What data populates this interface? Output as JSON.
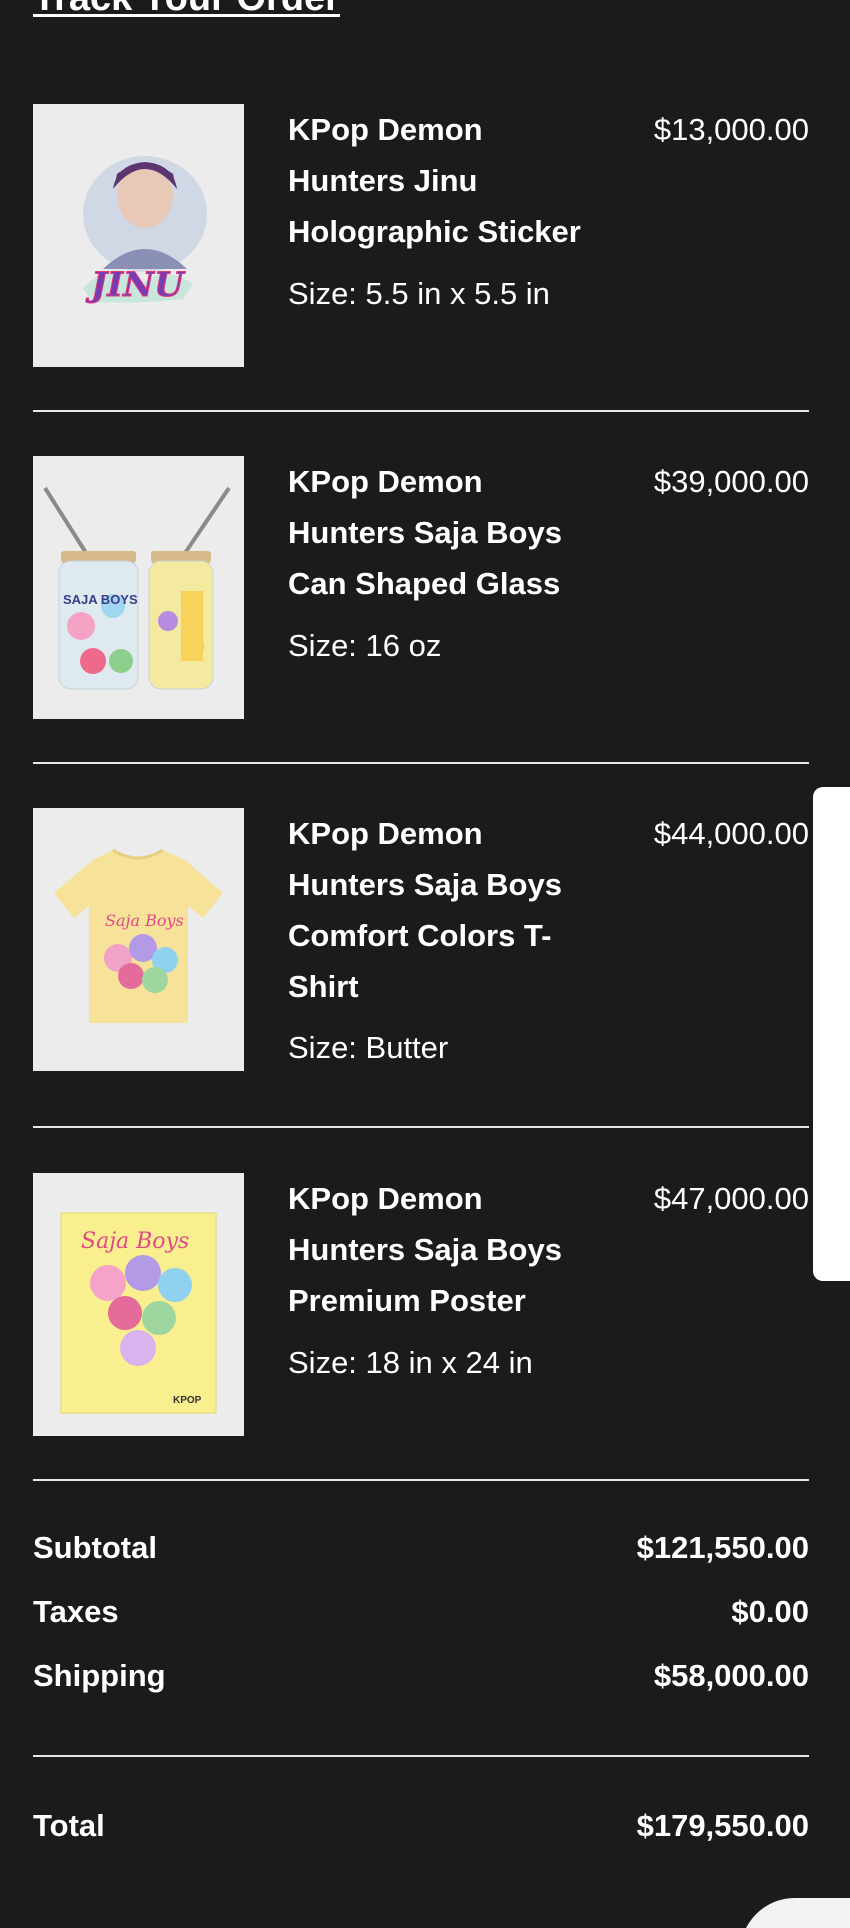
{
  "header": {
    "title": "Track Your Order"
  },
  "items": [
    {
      "name": "KPop Demon Hunters Jinu Holographic Sticker",
      "price": "$13,000.00",
      "variant": "Size: 5.5 in x 5.5 in",
      "image_label": "JINU",
      "image_icon": "sticker-image"
    },
    {
      "name": "KPop Demon Hunters Saja Boys Can Shaped Glass",
      "price": "$39,000.00",
      "variant": "Size: 16 oz",
      "image_label": "SAJA BOYS",
      "image_icon": "glass-image"
    },
    {
      "name": "KPop Demon Hunters Saja Boys Comfort Colors T-Shirt",
      "price": "$44,000.00",
      "variant": "Size: Butter",
      "image_label": "Saja Boys",
      "image_icon": "tshirt-image"
    },
    {
      "name": "KPop Demon Hunters Saja Boys Premium Poster",
      "price": "$47,000.00",
      "variant": "Size: 18 in x 24 in",
      "image_label": "Saja Boys",
      "image_label_2": "KPOP",
      "image_icon": "poster-image"
    }
  ],
  "summary": {
    "subtotal_label": "Subtotal",
    "subtotal_value": "$121,550.00",
    "taxes_label": "Taxes",
    "taxes_value": "$0.00",
    "shipping_label": "Shipping",
    "shipping_value": "$58,000.00",
    "total_label": "Total",
    "total_value": "$179,550.00"
  },
  "colors": {
    "background": "#1b1b1c",
    "text": "#ffffff",
    "divider": "#e6e6e6",
    "thumb_bg": "#ececec"
  }
}
